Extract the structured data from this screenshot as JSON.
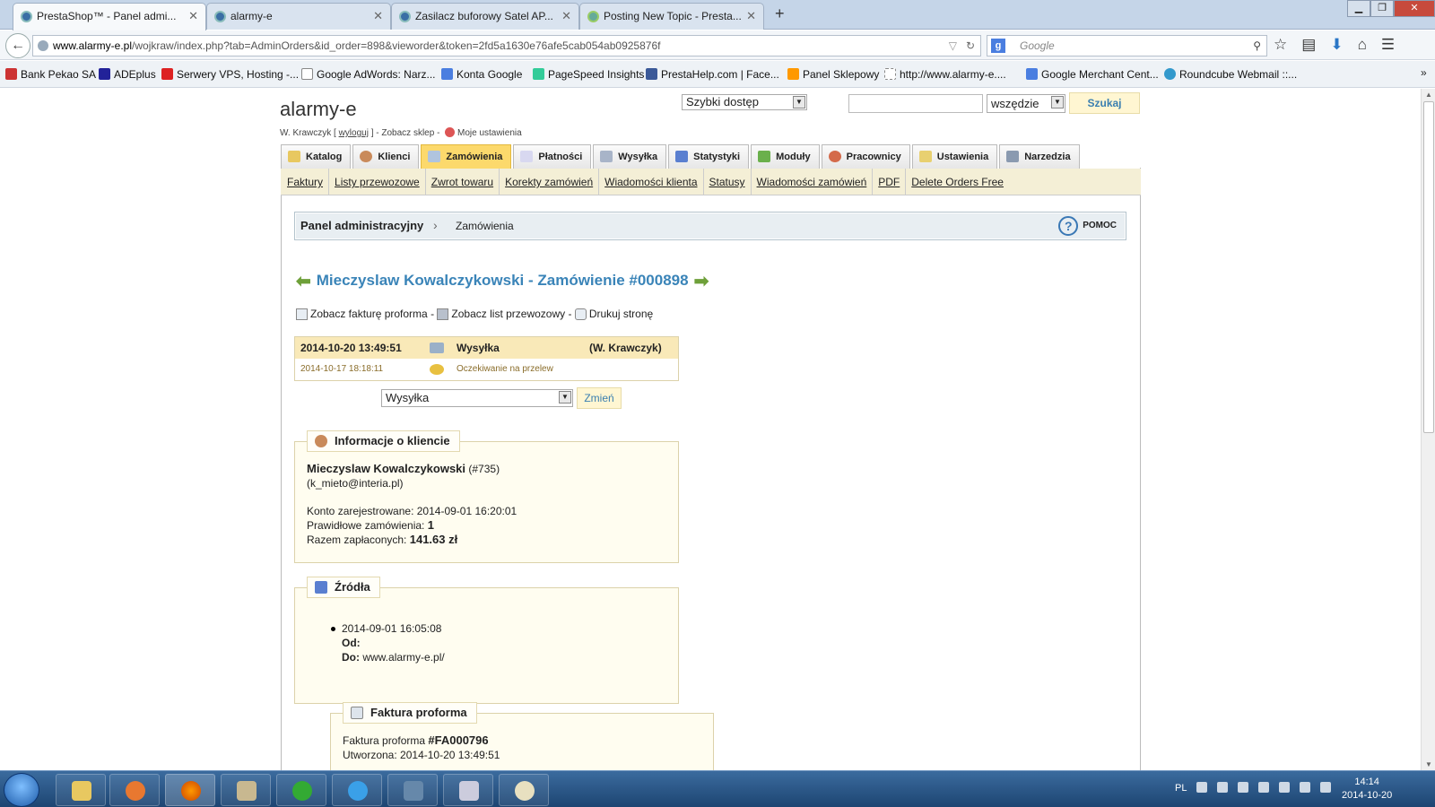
{
  "browser": {
    "tabs": [
      {
        "title": "PrestaShop™ - Panel admi..."
      },
      {
        "title": "alarmy-e"
      },
      {
        "title": "Zasilacz buforowy Satel AP..."
      },
      {
        "title": "Posting New Topic - Presta..."
      }
    ],
    "url_domain": "www.alarmy-e.pl",
    "url_path": "/wojkraw/index.php?tab=AdminOrders&id_order=898&vieworder&token=2fd5a1630e76afe5cab054ab0925876f",
    "search_placeholder": "Google",
    "bookmarks": [
      "Bank Pekao SA",
      "ADEplus",
      "Serwery VPS, Hosting -...",
      "Google AdWords: Narz...",
      "Konta Google",
      "PageSpeed Insights",
      "PrestaHelp.com | Face...",
      "Panel Sklepowy",
      "http://www.alarmy-e....",
      "Google Merchant Cent...",
      "Roundcube Webmail ::..."
    ]
  },
  "admin": {
    "shop_name": "alarmy-e",
    "user": {
      "name": "W. Krawczyk",
      "logout": "wyloguj",
      "view_shop": "Zobacz sklep",
      "settings": "Moje ustawienia"
    },
    "quick_access": "Szybki dostęp",
    "search_scope": "wszędzie",
    "search_button": "Szukaj",
    "menu": [
      {
        "label": "Katalog",
        "color": "#e8c860"
      },
      {
        "label": "Klienci",
        "color": "#c98a5a"
      },
      {
        "label": "Zamówienia",
        "color": "#b0c4de"
      },
      {
        "label": "Płatności",
        "color": "#d8d8f0"
      },
      {
        "label": "Wysyłka",
        "color": "#a8b4c8"
      },
      {
        "label": "Statystyki",
        "color": "#5a7fd0"
      },
      {
        "label": "Moduły",
        "color": "#6ab04c"
      },
      {
        "label": "Pracownicy",
        "color": "#d46a4a"
      },
      {
        "label": "Ustawienia",
        "color": "#e8d070"
      },
      {
        "label": "Narzedzia",
        "color": "#8a9ab0"
      }
    ],
    "submenu": [
      "Faktury",
      "Listy przewozowe",
      "Zwrot towaru",
      "Korekty zamówień",
      "Wiadomości klienta",
      "Statusy",
      "Wiadomości zamówień",
      "PDF",
      "Delete Orders Free"
    ],
    "breadcrumb": {
      "root": "Panel administracyjny",
      "current": "Zamówienia"
    },
    "help": "POMOC"
  },
  "order": {
    "title": "Mieczyslaw Kowalczykowski - Zamówienie #000898",
    "actions": {
      "invoice": "Zobacz fakturę proforma",
      "sep": "-",
      "delivery": "Zobacz list przewozowy",
      "print": "Drukuj stronę"
    },
    "history": [
      {
        "date": "2014-10-20 13:49:51",
        "status": "Wysyłka",
        "employee": "(W. Krawczyk)"
      },
      {
        "date": "2014-10-17 18:18:11",
        "status": "Oczekiwanie na przelew",
        "employee": ""
      }
    ],
    "status_select": "Wysyłka",
    "change_button": "Zmień",
    "customer": {
      "legend": "Informacje o kliencie",
      "name": "Mieczyslaw Kowalczykowski",
      "id": "(#735)",
      "email": "(k_mieto@interia.pl)",
      "registered_label": "Konto zarejestrowane:",
      "registered": "2014-09-01 16:20:01",
      "valid_orders_label": "Prawidłowe zamówienia:",
      "valid_orders": "1",
      "total_paid_label": "Razem zapłaconych:",
      "total_paid": "141.63 zł"
    },
    "sources": {
      "legend": "Źródła",
      "date": "2014-09-01 16:05:08",
      "from_label": "Od:",
      "to_label": "Do:",
      "to": "www.alarmy-e.pl/"
    },
    "invoice": {
      "legend": "Faktura proforma",
      "label": "Faktura proforma",
      "number": "#FA000796",
      "created_label": "Utworzona:",
      "created": "2014-10-20 13:49:51"
    }
  },
  "taskbar": {
    "lang": "PL",
    "time": "14:14",
    "date": "2014-10-20"
  }
}
